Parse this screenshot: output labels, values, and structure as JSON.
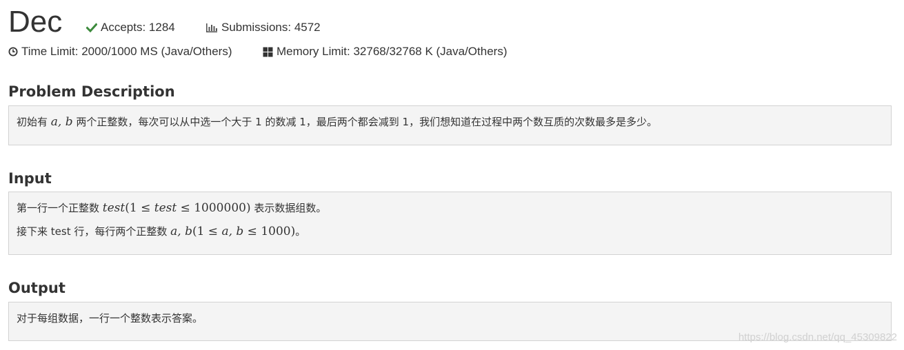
{
  "problem": {
    "title": "Dec",
    "accepts_label": "Accepts: 1284",
    "submissions_label": "Submissions: 4572",
    "time_limit": "Time Limit: 2000/1000 MS (Java/Others)",
    "memory_limit": "Memory Limit: 32768/32768 K (Java/Others)"
  },
  "sections": {
    "description": {
      "heading": "Problem Description",
      "text_a": "初始有 ",
      "math_a": "a, b",
      "text_b": " 两个正整数，每次可以从中选一个大于 1 的数减 1，最后两个都会减到 1，我们想知道在过程中两个数互质的次数最多是多少。"
    },
    "input": {
      "heading": "Input",
      "line1_a": "第一行一个正整数 ",
      "line1_math_var": "test",
      "line1_math_rest": "(1 ≤ ",
      "line1_math_var2": "test",
      "line1_math_end": " ≤ 1000000)",
      "line1_b": " 表示数据组数。",
      "line2_a": "接下来 test 行，每行两个正整数 ",
      "line2_math": "a, b",
      "line2_math_end": "(1 ≤ ",
      "line2_math_vars": "a, b",
      "line2_math_tail": " ≤ 1000)",
      "line2_b": "。"
    },
    "output": {
      "heading": "Output",
      "text": "对于每组数据，一行一个整数表示答案。"
    }
  },
  "watermark": "https://blog.csdn.net/qq_45309822",
  "colors": {
    "accept_check": "#3c8a3c",
    "text": "#333333",
    "box_bg": "#f4f4f4",
    "box_border": "#d2d2d2"
  }
}
